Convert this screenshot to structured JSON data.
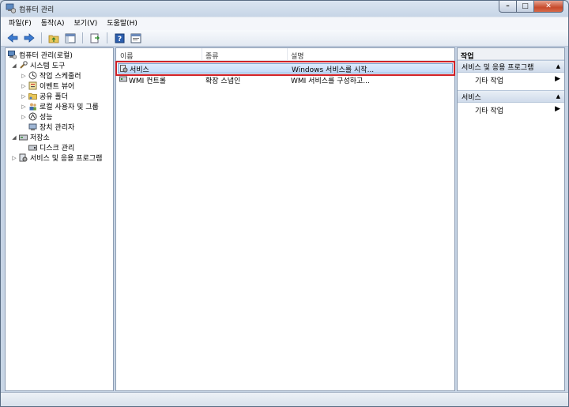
{
  "window": {
    "title": "컴퓨터 관리",
    "buttons": {
      "minimize": "–",
      "maximize": "□",
      "close": "✕"
    }
  },
  "menu": [
    "파일(F)",
    "동작(A)",
    "보기(V)",
    "도움말(H)"
  ],
  "toolbar": {
    "icons": [
      "back-arrow-icon",
      "forward-arrow-icon",
      "folder-up-icon",
      "show-hide-tree-icon",
      "export-list-icon",
      "help-icon",
      "properties-icon"
    ]
  },
  "tree": {
    "root": "컴퓨터 관리(로컬)",
    "items": [
      {
        "label": "시스템 도구"
      },
      {
        "label": "작업 스케줄러"
      },
      {
        "label": "이벤트 뷰어"
      },
      {
        "label": "공유 폴더"
      },
      {
        "label": "로컬 사용자 및 그룹"
      },
      {
        "label": "성능"
      },
      {
        "label": "장치 관리자"
      },
      {
        "label": "저장소"
      },
      {
        "label": "디스크 관리"
      },
      {
        "label": "서비스 및 응용 프로그램"
      }
    ]
  },
  "list": {
    "columns": [
      "이름",
      "종류",
      "설명"
    ],
    "rows": [
      {
        "name": "서비스",
        "type": "",
        "description": "Windows 서비스를 시작..."
      },
      {
        "name": "WMI 컨트롤",
        "type": "확장 스냅인",
        "description": "WMI 서비스를 구성하고..."
      }
    ]
  },
  "actions": {
    "header": "작업",
    "groups": [
      {
        "title": "서비스 및 응용 프로그램",
        "item": "기타 작업"
      },
      {
        "title": "서비스",
        "item": "기타 작업"
      }
    ]
  },
  "colors": {
    "selection_outline": "#d02127",
    "selection_fill": "#c4dcfa"
  }
}
